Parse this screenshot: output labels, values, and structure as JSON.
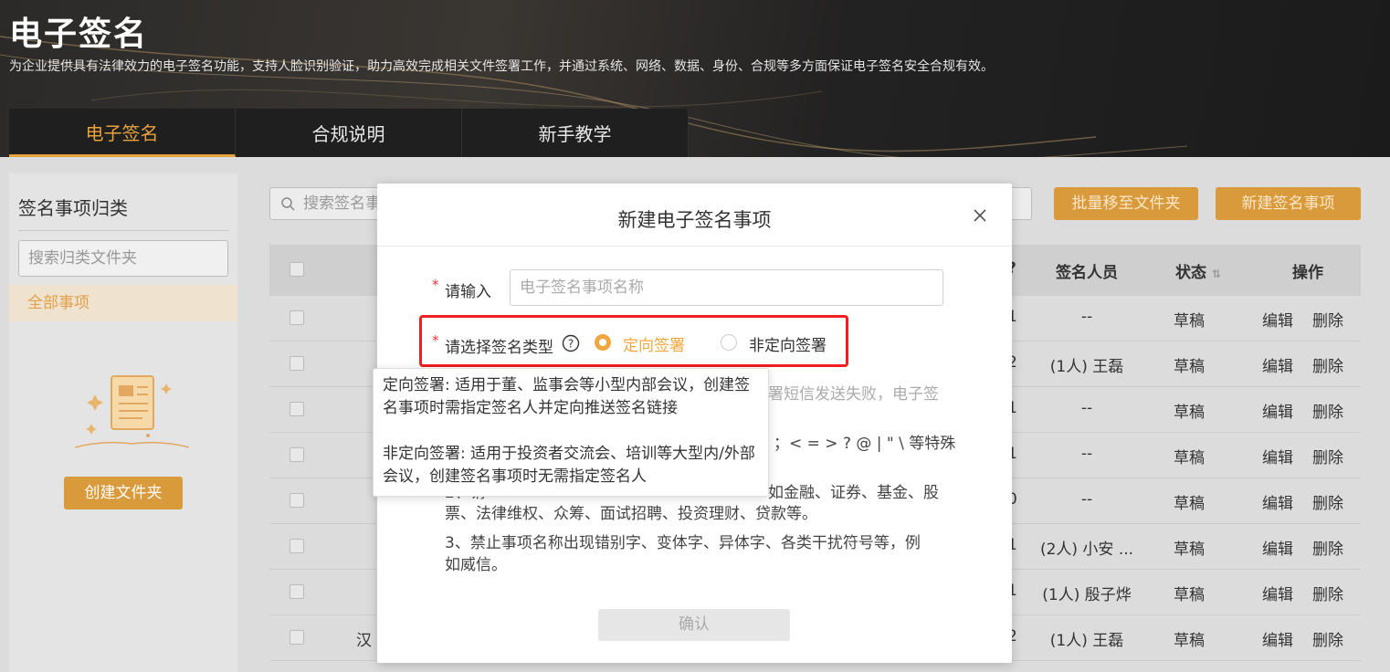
{
  "header": {
    "title": "电子签名",
    "description": "为企业提供具有法律效力的电子签名功能，支持人脸识别验证，助力高效完成相关文件签署工作，并通过系统、网络、数据、身份、合规等多方面保证电子签名安全合规有效。",
    "tabs": [
      {
        "label": "电子签名",
        "active": true
      },
      {
        "label": "合规说明",
        "active": false
      },
      {
        "label": "新手教学",
        "active": false
      }
    ]
  },
  "sidebar": {
    "title": "签名事项归类",
    "search_placeholder": "搜索归类文件夹",
    "items": [
      {
        "label": "全部事项"
      }
    ],
    "create_folder_label": "创建文件夹"
  },
  "toolbar": {
    "search_placeholder": "搜索签名事项",
    "batch_move_label": "批量移至文件夹",
    "new_item_label": "新建签名事项"
  },
  "table": {
    "headers": {
      "col_partial": "?",
      "signers": "签名人员",
      "status": "状态",
      "actions": "操作"
    },
    "rows": [
      {
        "num": "1",
        "signers": "--",
        "status": "草稿",
        "edit": "编辑",
        "delete": "删除"
      },
      {
        "num": "2",
        "signers": "(1人) 王磊",
        "status": "草稿",
        "edit": "编辑",
        "delete": "删除"
      },
      {
        "num": "1",
        "signers": "--",
        "status": "草稿",
        "edit": "编辑",
        "delete": "删除"
      },
      {
        "num": "1",
        "signers": "--",
        "status": "草稿",
        "edit": "编辑",
        "delete": "删除"
      },
      {
        "num": "0",
        "signers": "--",
        "status": "草稿",
        "edit": "编辑",
        "delete": "删除"
      },
      {
        "num": "1",
        "signers": "(2人) 小安 ...",
        "status": "草稿",
        "edit": "编辑",
        "delete": "删除"
      },
      {
        "num": "1",
        "signers": "(1人) 殷子烨",
        "status": "草稿",
        "edit": "编辑",
        "delete": "删除"
      },
      {
        "num": "2",
        "signers": "(1人) 王磊",
        "status": "草稿",
        "edit": "编辑",
        "delete": "删除"
      }
    ],
    "last_row_prefix": "汉"
  },
  "modal": {
    "title": "新建电子签名事项",
    "name_label": "请输入",
    "name_placeholder": "电子签名事项名称",
    "type_label": "请选择签名类型",
    "options": [
      {
        "label": "定向签署",
        "selected": true
      },
      {
        "label": "非定向签署",
        "selected": false
      }
    ],
    "notes": {
      "line1_tail": "署短信发送失败，电子签",
      "line2_tail": "；< = > ? @ | \" \\ 等特殊",
      "line3_fragment": "2、请",
      "line3_tail": "如金融、证券、基金、股",
      "line4": "票、法律维权、众筹、面试招聘、投资理财、贷款等。",
      "line5": "3、禁止事项名称出现错别字、变体字、异体字、各类干扰符号等，例",
      "line6": "如威信。"
    },
    "confirm_label": "确认"
  },
  "tooltip": {
    "directed": "定向签署: 适用于董、监事会等小型内部会议，创建签名事项时需指定签名人并定向推送签名链接",
    "undirected": "非定向签署: 适用于投资者交流会、培训等大型内/外部会议，创建签名事项时无需指定签名人"
  },
  "colors": {
    "accent": "#e8a23c",
    "button": "#d99a3c",
    "highlight_box": "#f01e1e"
  }
}
